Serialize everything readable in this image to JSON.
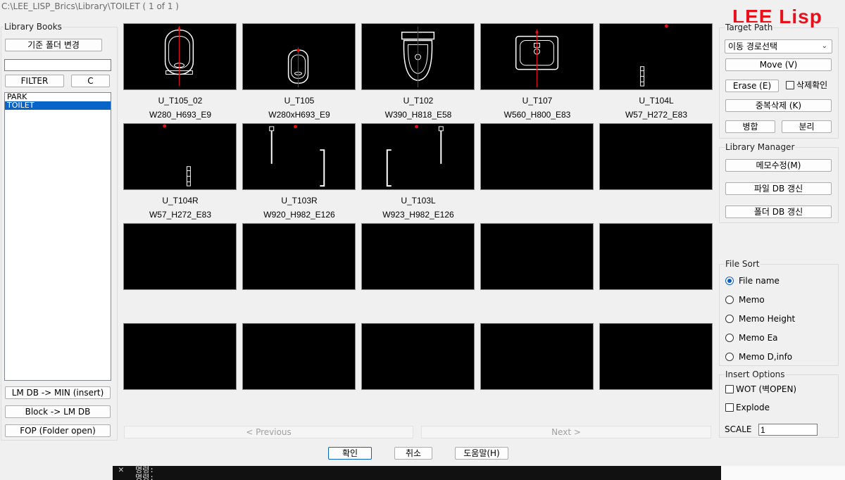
{
  "window": {
    "title": "C:\\LEE_LISP_Brics\\Library\\TOILET   ( 1 of 1 )"
  },
  "brand": {
    "text": "LEE Lisp",
    "color": "#e8101a"
  },
  "library_books": {
    "label": "Library Books",
    "base_folder_button": "기준 폴더 변경",
    "filter_input": "",
    "filter_button": "FILTER",
    "clear_button": "C",
    "items": [
      {
        "label": "PARK",
        "selected": false
      },
      {
        "label": "TOILET",
        "selected": true
      }
    ],
    "lm_db_min_button": "LM DB -> MIN (insert)",
    "block_lm_db_button": "Block -> LM DB",
    "fop_button": "FOP (Folder open)"
  },
  "grid": {
    "thumbnails": [
      {
        "name": "U_T105_02",
        "info": "W280_H693_E9",
        "icon": "urinal-icon"
      },
      {
        "name": "U_T105",
        "info": "W280xH693_E9",
        "icon": "urinal-small-icon"
      },
      {
        "name": "U_T102",
        "info": "W390_H818_E58",
        "icon": "toilet-icon"
      },
      {
        "name": "U_T107",
        "info": "W560_H800_E83",
        "icon": "washbasin-icon"
      },
      {
        "name": "U_T104L",
        "info": "W57_H272_E83",
        "icon": "faucet-icon"
      },
      {
        "name": "U_T104R",
        "info": "W57_H272_E83",
        "icon": "faucet-icon"
      },
      {
        "name": "U_T103R",
        "info": "W920_H982_E126",
        "icon": "grab-bar-icon"
      },
      {
        "name": "U_T103L",
        "info": "W923_H982_E126",
        "icon": "grab-bar-icon"
      },
      {
        "name": "",
        "info": "",
        "icon": ""
      },
      {
        "name": "",
        "info": "",
        "icon": ""
      },
      {
        "name": "",
        "info": "",
        "icon": ""
      },
      {
        "name": "",
        "info": "",
        "icon": ""
      },
      {
        "name": "",
        "info": "",
        "icon": ""
      },
      {
        "name": "",
        "info": "",
        "icon": ""
      },
      {
        "name": "",
        "info": "",
        "icon": ""
      },
      {
        "name": "",
        "info": "",
        "icon": ""
      },
      {
        "name": "",
        "info": "",
        "icon": ""
      },
      {
        "name": "",
        "info": "",
        "icon": ""
      },
      {
        "name": "",
        "info": "",
        "icon": ""
      },
      {
        "name": "",
        "info": "",
        "icon": ""
      }
    ],
    "previous_button": "< Previous",
    "next_button": "Next >"
  },
  "target_path": {
    "label": "Target Path",
    "select_value": "이동 경로선택",
    "move_button": "Move (V)",
    "erase_button": "Erase (E)",
    "delete_confirm_label": "삭제확인",
    "dedupe_button": "중복삭제 (K)",
    "merge_button": "병합",
    "split_button": "분리"
  },
  "library_manager": {
    "label": "Library Manager",
    "memo_edit_button": "메모수정(M)",
    "file_db_refresh_button": "파일 DB 갱신",
    "folder_db_refresh_button": "폴더 DB 갱신"
  },
  "file_sort": {
    "label": "File Sort",
    "options": [
      {
        "label": "File name",
        "selected": true
      },
      {
        "label": "Memo",
        "selected": false
      },
      {
        "label": "Memo Height",
        "selected": false
      },
      {
        "label": "Memo Ea",
        "selected": false
      },
      {
        "label": "Memo D,info",
        "selected": false
      }
    ]
  },
  "insert_options": {
    "label": "Insert Options",
    "wot_label": "WOT (벽OPEN)",
    "explode_label": "Explode",
    "scale_label": "SCALE",
    "scale_value": "1"
  },
  "footer": {
    "ok_button": "확인",
    "cancel_button": "취소",
    "help_button": "도움말(H)"
  },
  "console": {
    "line1": "명령:",
    "line2": "명령:"
  }
}
